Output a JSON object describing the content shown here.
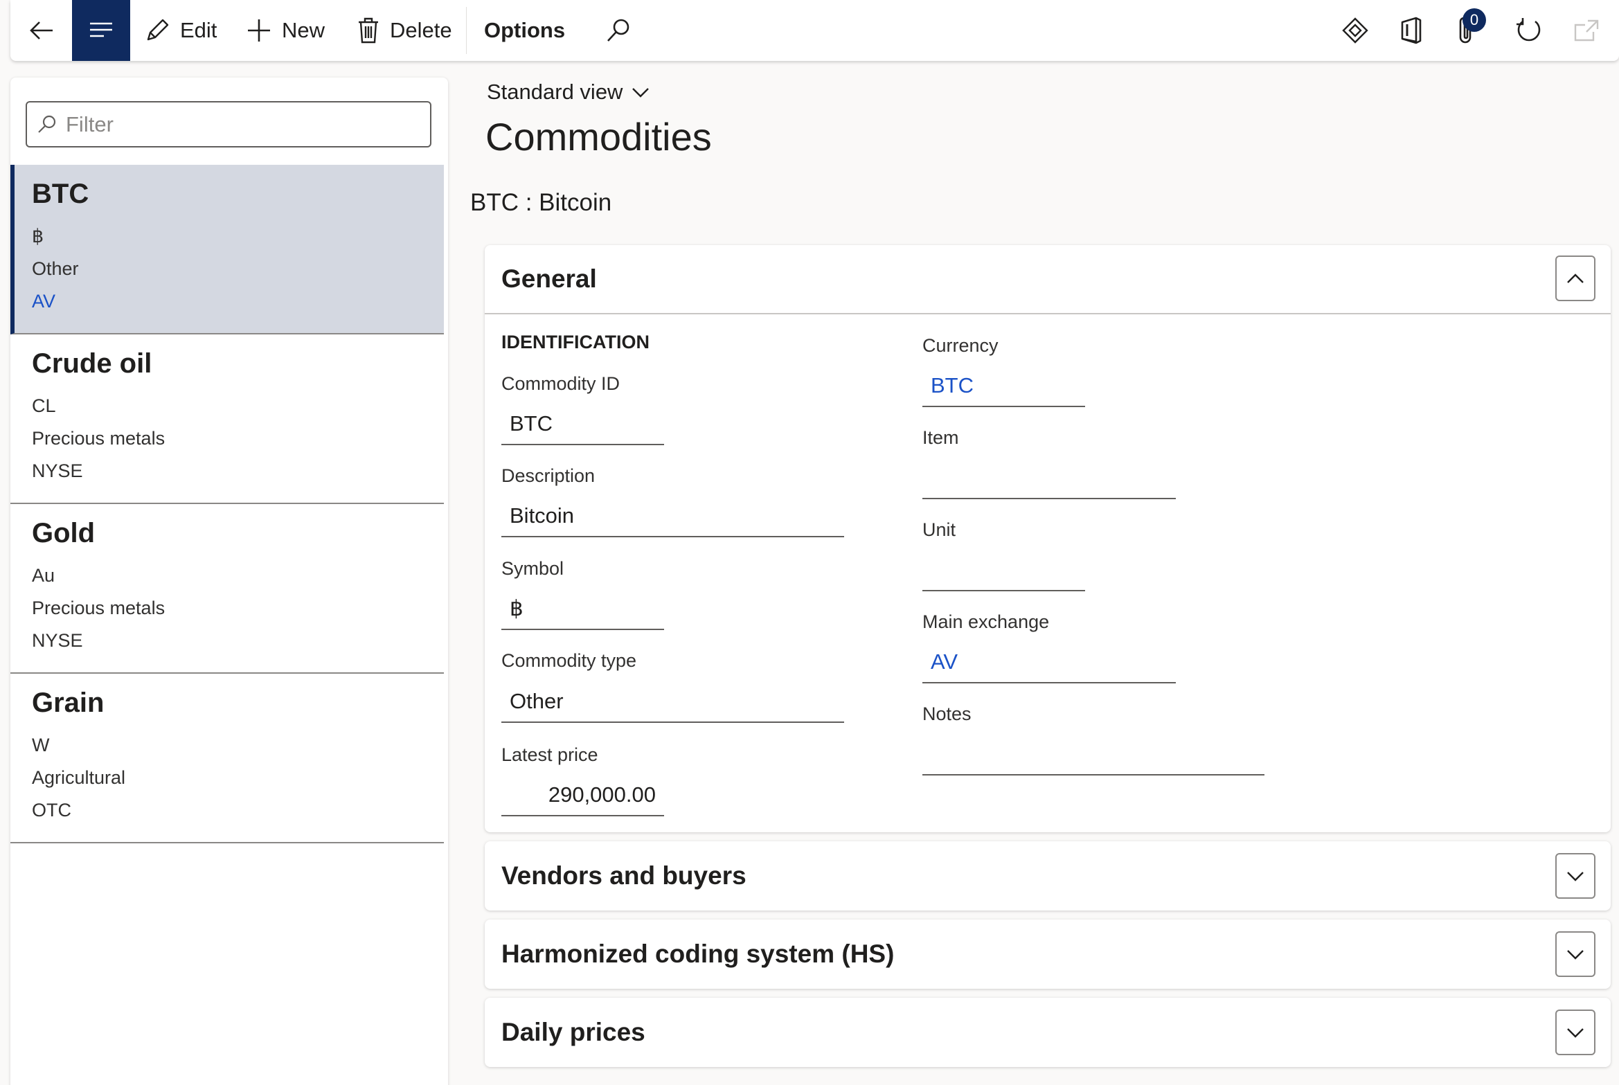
{
  "toolbar": {
    "edit_label": "Edit",
    "new_label": "New",
    "delete_label": "Delete",
    "options_label": "Options",
    "attachments_count": "0"
  },
  "filter": {
    "placeholder": "Filter"
  },
  "list": [
    {
      "title": "BTC",
      "line1": "฿",
      "line2": "Other",
      "line3": "AV",
      "selected": true
    },
    {
      "title": "Crude oil",
      "line1": "CL",
      "line2": "Precious metals",
      "line3": "NYSE"
    },
    {
      "title": "Gold",
      "line1": "Au",
      "line2": "Precious metals",
      "line3": "NYSE"
    },
    {
      "title": "Grain",
      "line1": "W",
      "line2": "Agricultural",
      "line3": "OTC"
    }
  ],
  "header": {
    "view_selector": "Standard view",
    "page_title": "Commodities",
    "record_title": "BTC : Bitcoin"
  },
  "general": {
    "title": "General",
    "identification_label": "IDENTIFICATION",
    "commodity_id_label": "Commodity ID",
    "commodity_id": "BTC",
    "description_label": "Description",
    "description": "Bitcoin",
    "symbol_label": "Symbol",
    "symbol": "฿",
    "commodity_type_label": "Commodity type",
    "commodity_type": "Other",
    "latest_price_label": "Latest price",
    "latest_price": "290,000.00",
    "currency_label": "Currency",
    "currency": "BTC",
    "item_label": "Item",
    "item": "",
    "unit_label": "Unit",
    "unit": "",
    "main_exchange_label": "Main exchange",
    "main_exchange": "AV",
    "notes_label": "Notes",
    "notes": ""
  },
  "tabs": {
    "vendors": "Vendors and buyers",
    "hs": "Harmonized coding system (HS)",
    "daily": "Daily prices"
  },
  "colors": {
    "accent": "#0f2a5f",
    "link": "#1b52c7",
    "selected_row": "#d4d8e1"
  }
}
